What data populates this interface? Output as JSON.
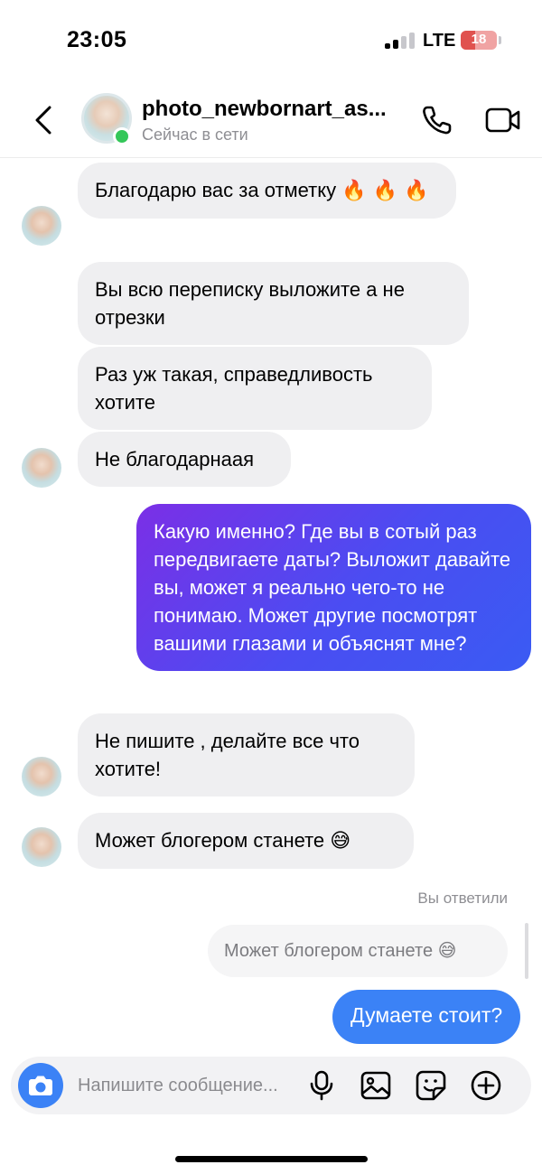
{
  "status_bar": {
    "time": "23:05",
    "network": "LTE",
    "battery": "18",
    "battery_color": "#e0524f"
  },
  "header": {
    "contact_name": "photo_newbornart_as...",
    "contact_status": "Сейчас в сети",
    "online_color": "#34c759"
  },
  "messages": [
    {
      "from": "them",
      "text": "Благодарю вас за отметку",
      "emoji": "🔥 🔥 🔥"
    },
    {
      "from": "them",
      "text": "Вы всю переписку выложите а не отрезки"
    },
    {
      "from": "them",
      "text": "Раз уж такая, справедливость хотите"
    },
    {
      "from": "them",
      "text": "Не благодарнаая"
    },
    {
      "from": "me",
      "text": "Какую именно? Где вы в сотый раз передвигаете даты? Выложит давайте вы, может я реально чего-то не понимаю. Может другие посмотрят вашими глазами и объяснят мне?"
    },
    {
      "from": "them",
      "text": "Не пишите , делайте все что хотите!"
    },
    {
      "from": "them",
      "text": "Может блогером станете",
      "emoji": "😅"
    }
  ],
  "reply": {
    "label": "Вы ответили",
    "quoted_text": "Может блогером станете",
    "quoted_emoji": "😅",
    "text": "Думаете стоит?",
    "color": "#3b82f6"
  },
  "composer": {
    "placeholder": "Напишите сообщение..."
  },
  "icons": {
    "back": "chevron-left-icon",
    "call": "phone-icon",
    "video": "video-camera-icon",
    "camera": "camera-icon",
    "mic": "microphone-icon",
    "gallery": "image-icon",
    "sticker": "sticker-icon",
    "more": "plus-circle-icon"
  }
}
